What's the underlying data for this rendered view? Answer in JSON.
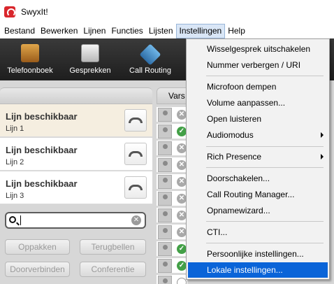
{
  "window": {
    "title": "SwyxIt!"
  },
  "menubar": [
    {
      "label": "Bestand"
    },
    {
      "label": "Bewerken"
    },
    {
      "label": "Lijnen"
    },
    {
      "label": "Functies"
    },
    {
      "label": "Lijsten"
    },
    {
      "label": "Instellingen"
    },
    {
      "label": "Help"
    }
  ],
  "toolbar": [
    {
      "label": "Telefoonboek",
      "icon": "phonebook-icon"
    },
    {
      "label": "Gesprekken",
      "icon": "call-journal-icon"
    },
    {
      "label": "Call Routing",
      "icon": "call-routing-icon"
    }
  ],
  "lines": [
    {
      "name": "Lijn beschikbaar",
      "sub": "Lijn 1",
      "selected": true
    },
    {
      "name": "Lijn beschikbaar",
      "sub": "Lijn 2",
      "selected": false
    },
    {
      "name": "Lijn beschikbaar",
      "sub": "Lijn 3",
      "selected": false
    }
  ],
  "search": {
    "value": "",
    "placeholder": ""
  },
  "buttons": [
    {
      "label": "Oppakken"
    },
    {
      "label": "Terugbellen"
    },
    {
      "label": "Doorverbinden"
    },
    {
      "label": "Conferentie"
    }
  ],
  "middle": {
    "tab_label": "Vars"
  },
  "contacts": [
    {
      "status": "busy"
    },
    {
      "status": "free"
    },
    {
      "status": "busy"
    },
    {
      "status": "busy"
    },
    {
      "status": "busy"
    },
    {
      "status": "busy"
    },
    {
      "status": "busy"
    },
    {
      "status": "busy"
    },
    {
      "status": "free"
    },
    {
      "status": "free"
    },
    {
      "status": "off"
    }
  ],
  "dropdown": {
    "items": [
      {
        "label": "Wisselgesprek uitschakelen"
      },
      {
        "label": "Nummer verbergen / URI"
      },
      {
        "label": "Microfoon dempen"
      },
      {
        "label": "Volume aanpassen..."
      },
      {
        "label": "Open luisteren"
      },
      {
        "label": "Audiomodus",
        "submenu": true
      },
      {
        "label": "Rich Presence",
        "submenu": true
      },
      {
        "label": "Doorschakelen..."
      },
      {
        "label": "Call Routing Manager..."
      },
      {
        "label": "Opnamewizard..."
      },
      {
        "label": "CTI..."
      },
      {
        "label": "Persoonlijke instellingen..."
      },
      {
        "label": "Lokale instellingen...",
        "highlighted": true
      }
    ]
  },
  "colors": {
    "highlight": "#0a64d8",
    "toolbar_bg": "#2a2a2a",
    "app_red": "#d9262c",
    "status_green": "#43a047"
  }
}
